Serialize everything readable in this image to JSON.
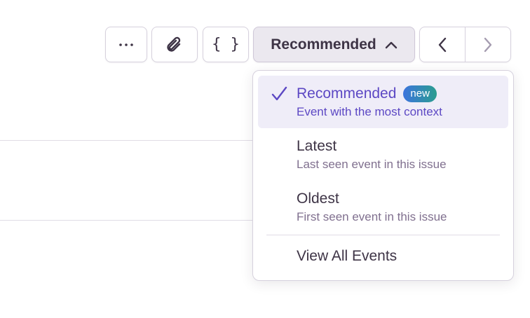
{
  "toolbar": {
    "more_label": "···",
    "json_label": "{ }",
    "sort_label": "Recommended",
    "icons": {
      "more": "ellipsis-icon",
      "attach": "paperclip-icon",
      "sort_toggle": "chevron-up-icon",
      "prev": "chevron-left-icon",
      "next": "chevron-right-icon"
    }
  },
  "menu": {
    "items": [
      {
        "title": "Recommended",
        "badge": "new",
        "description": "Event with the most context",
        "selected": true
      },
      {
        "title": "Latest",
        "description": "Last seen event in this issue",
        "selected": false
      },
      {
        "title": "Oldest",
        "description": "First seen event in this issue",
        "selected": false
      }
    ],
    "view_all_label": "View All Events"
  },
  "colors": {
    "accent": "#5c48c4",
    "selected_bg": "#efedf8",
    "badge_start": "#3c74dd",
    "badge_end": "#2a9d8f",
    "border": "#d6d1dd",
    "muted_text": "#80708f"
  }
}
